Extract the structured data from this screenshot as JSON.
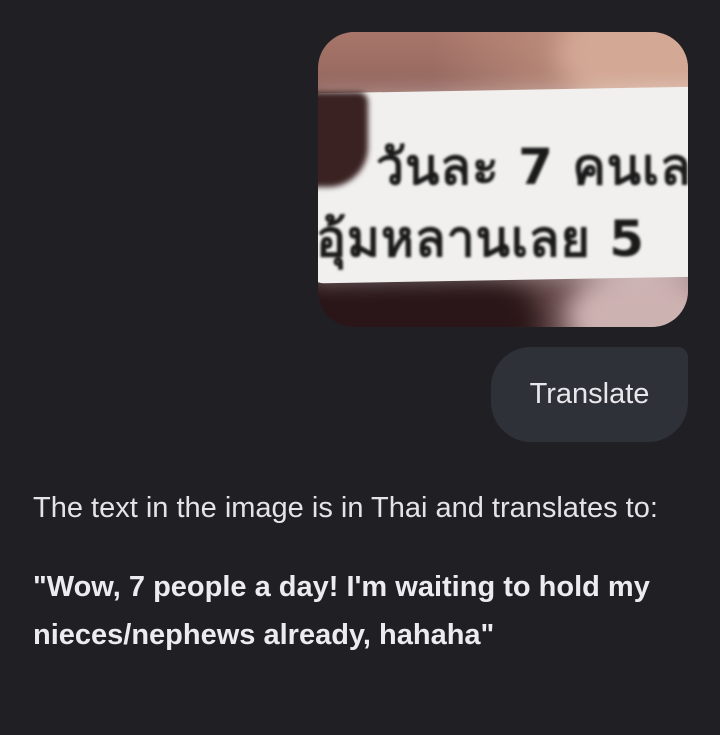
{
  "user_message": {
    "image_sign_text": {
      "line1": "วันละ 7 คนเล",
      "line2": "อุ้มหลานเลย 5"
    },
    "text": "Translate"
  },
  "assistant_message": {
    "intro": "The text in the image is in Thai and translates to:",
    "translation": "\"Wow, 7 people a day! I'm waiting to hold my nieces/nephews already, hahaha\""
  },
  "colors": {
    "background": "#1f1f24",
    "bubble": "#2f3139",
    "text": "#e4e4e8"
  }
}
